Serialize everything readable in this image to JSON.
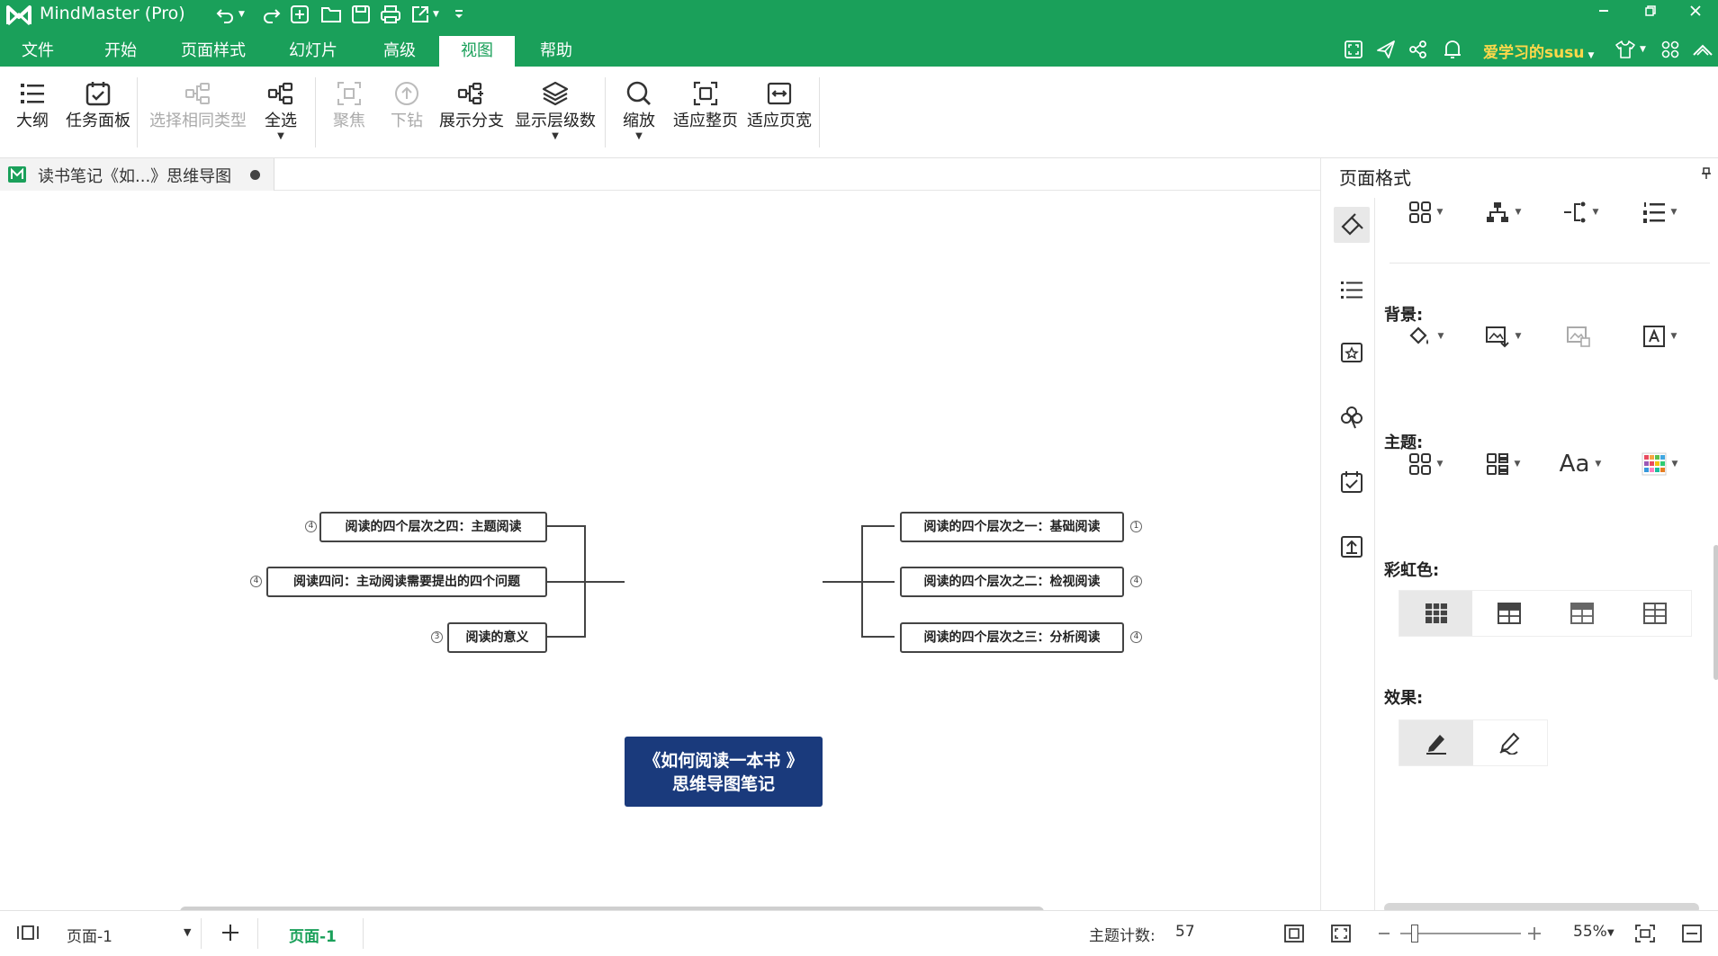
{
  "app": {
    "title": "MindMaster (Pro)"
  },
  "menu": {
    "items": [
      {
        "label": "文件"
      },
      {
        "label": "开始"
      },
      {
        "label": "页面样式"
      },
      {
        "label": "幻灯片"
      },
      {
        "label": "高级"
      },
      {
        "label": "视图"
      },
      {
        "label": "帮助"
      }
    ],
    "active": "视图"
  },
  "user": {
    "name": "爱学习的susu"
  },
  "ribbon": {
    "outline": "大纲",
    "task_panel": "任务面板",
    "select_same_type": "选择相同类型",
    "select_all": "全选",
    "focus": "聚焦",
    "drill_down": "下钻",
    "expand_branch": "展示分支",
    "show_levels": "显示层级数",
    "zoom": "缩放",
    "fit_page": "适应整页",
    "fit_width": "适应页宽"
  },
  "document": {
    "tab_title": "读书笔记《如...》思维导图"
  },
  "mindmap": {
    "central": {
      "line1": "《如何阅读一本书 》",
      "line2": "思维导图笔记"
    },
    "left_topics": [
      {
        "label": "阅读的四个层次之四：主题阅读",
        "badge": "4"
      },
      {
        "label": "阅读四问：主动阅读需要提出的四个问题",
        "badge": "4"
      },
      {
        "label": "阅读的意义",
        "badge": "3"
      }
    ],
    "right_topics": [
      {
        "label": "阅读的四个层次之一：基础阅读",
        "badge": "1"
      },
      {
        "label": "阅读的四个层次之二：检视阅读",
        "badge": "4"
      },
      {
        "label": "阅读的四个层次之三：分析阅读",
        "badge": "4"
      }
    ]
  },
  "panel": {
    "title": "页面格式",
    "background_label": "背景:",
    "theme_label": "主题:",
    "rainbow_label": "彩虹色:",
    "effect_label": "效果:",
    "font_button": "Aa"
  },
  "status": {
    "page_select": "页面-1",
    "page_tab": "页面-1",
    "topic_count_label": "主题计数:",
    "topic_count": "57",
    "zoom": "55%"
  },
  "colors": {
    "brand": "#1aa05a",
    "central_fill": "#1a3a7c",
    "username": "#ffd84a"
  }
}
